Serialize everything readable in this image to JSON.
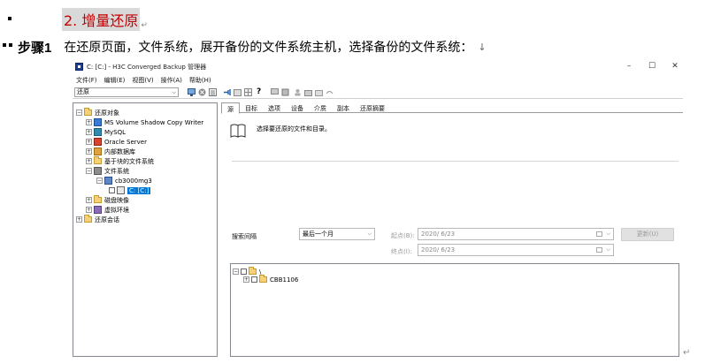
{
  "doc": {
    "heading_number": "2.",
    "heading_text": "增量还原",
    "step_label": "步骤1",
    "step_text": "在还原页面，文件系统，展开备份的文件系统主机，选择备份的文件系统：",
    "step_arrow": "↓",
    "pilcrow": "↵"
  },
  "window": {
    "title": "C: [C:] - H3C Converged Backup 管理器",
    "controls": {
      "minimize": "–",
      "maximize": "☐",
      "close": "✕"
    },
    "menu": [
      "文件(F)",
      "编辑(E)",
      "视图(V)",
      "操作(A)",
      "帮助(H)"
    ],
    "toolbar": {
      "dropdown_value": "还原",
      "dropdown_arrow": "⌵",
      "help_glyph": "?"
    }
  },
  "tree": {
    "root": "还原对象",
    "items": [
      {
        "label": "MS Volume Shadow Copy Writer",
        "icon": "vss-writer-icon"
      },
      {
        "label": "MySQL",
        "icon": "mysql-icon"
      },
      {
        "label": "Oracle Server",
        "icon": "oracle-icon"
      },
      {
        "label": "内部数据库",
        "icon": "internal-db-icon"
      },
      {
        "label": "基于块的文件系统",
        "icon": "folder-icon"
      },
      {
        "label": "文件系统",
        "icon": "filesystem-icon"
      },
      {
        "label": "cb3000mg3",
        "icon": "host-icon"
      },
      {
        "label": "C: [C:]",
        "icon": "drive-icon"
      },
      {
        "label": "磁盘映像",
        "icon": "folder-icon"
      },
      {
        "label": "虚拟环境",
        "icon": "virtual-env-icon"
      },
      {
        "label": "还原会话",
        "icon": "folder-icon"
      }
    ],
    "expand_plus": "+",
    "expand_minus": "−"
  },
  "tabs": [
    "源",
    "目标",
    "选项",
    "设备",
    "介质",
    "副本",
    "还原摘要"
  ],
  "source_panel": {
    "instruction": "选择要还原的文件和目录。",
    "search_interval_label": "搜索间隔",
    "search_interval_value": "最后一个月",
    "start_label": "起点(B):",
    "start_value": "2020/  6/23",
    "end_label": "终点(I):",
    "end_value": "2020/  6/23",
    "update_button": "更新(U)",
    "caret": "⌵",
    "file_tree": [
      {
        "label": "\\"
      },
      {
        "label": "CBB1106"
      }
    ]
  },
  "colors": {
    "heading": "#c00000",
    "selection": "#0078d7",
    "folder": "#f5d27a"
  }
}
